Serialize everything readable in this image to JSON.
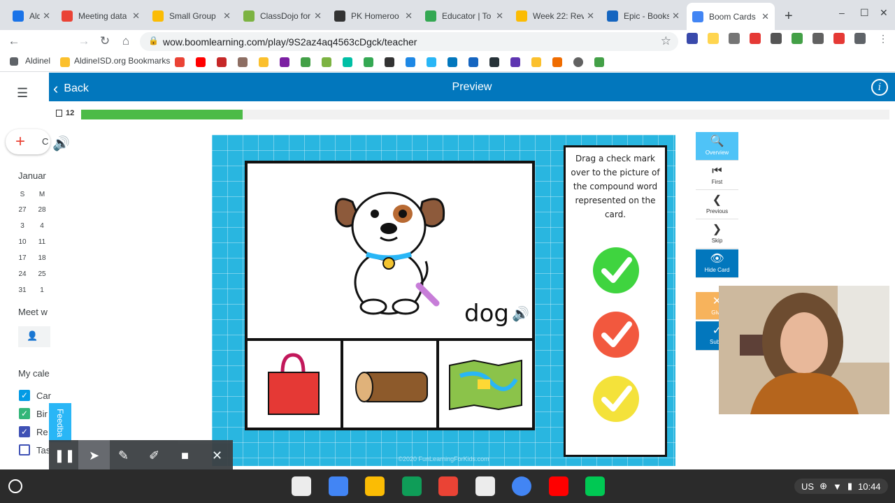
{
  "browser": {
    "tabs": [
      {
        "label": "Aldine",
        "color": "#1a73e8"
      },
      {
        "label": "Meeting data",
        "color": "#ea4335"
      },
      {
        "label": "Small Group",
        "color": "#fbbc04"
      },
      {
        "label": "ClassDojo for",
        "color": "#7cb342"
      },
      {
        "label": "PK Homeroo",
        "color": "#333333"
      },
      {
        "label": "Educator | To",
        "color": "#34a853"
      },
      {
        "label": "Week 22: Rev",
        "color": "#fbbc04"
      },
      {
        "label": "Epic - Books",
        "color": "#1565c0"
      },
      {
        "label": "Boom Cards",
        "color": "#4285f4"
      }
    ],
    "url": "wow.boomlearning.com/play/9S2az4aq4563cDgck/teacher",
    "bookmarks_left": "Aldinel",
    "bookmarks_folder": "AldineISD.org Bookmarks"
  },
  "calendar": {
    "create": "C",
    "month": "Januar",
    "weekdays": [
      "S",
      "M"
    ],
    "days": [
      [
        "27",
        "28"
      ],
      [
        "3",
        "4"
      ],
      [
        "10",
        "11"
      ],
      [
        "17",
        "18"
      ],
      [
        "24",
        "25"
      ],
      [
        "31",
        "1"
      ]
    ],
    "meet": "Meet w",
    "my_calendars": "My cale",
    "calendars": [
      {
        "label": "Car",
        "color": "#039be5",
        "checked": true
      },
      {
        "label": "Bir",
        "color": "#33b679",
        "checked": true
      },
      {
        "label": "Re",
        "color": "#3f51b5",
        "checked": true
      },
      {
        "label": "Tas",
        "color": "#3f51b5",
        "checked": false
      }
    ]
  },
  "boom": {
    "back": "Back",
    "title": "Preview",
    "card_count": "12",
    "progress_fraction": 0.2,
    "word": "dog",
    "instructions": "Drag a check mark over to the picture of the compound word represented on the card.",
    "watermark": "©2020 FunLearningForKids.com",
    "controls": [
      {
        "icon": "magnifier-icon",
        "glyph": "🔍",
        "label": "Overview",
        "style": "blue"
      },
      {
        "icon": "skip-first-icon",
        "glyph": "⏮",
        "label": "First",
        "style": "white"
      },
      {
        "icon": "chevron-left-icon",
        "glyph": "❮",
        "label": "Previous",
        "style": "white"
      },
      {
        "icon": "chevron-right-icon",
        "glyph": "❯",
        "label": "Skip",
        "style": "white"
      },
      {
        "icon": "eye-icon",
        "glyph": "👁",
        "label": "Hide Card",
        "style": "dblue"
      }
    ],
    "give_up": "Give",
    "submit": "Subm",
    "feedback": "Feedba",
    "checks": [
      {
        "color": "#3fd43f"
      },
      {
        "color": "#f2583e"
      },
      {
        "color": "#f4e23a"
      }
    ]
  },
  "shelf": {
    "time": "10:44",
    "locale": "US"
  }
}
